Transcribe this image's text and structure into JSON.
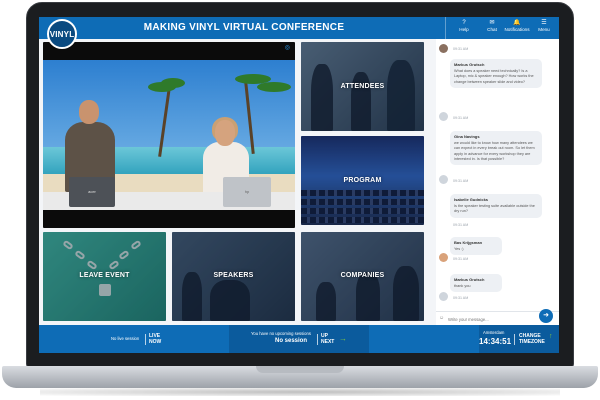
{
  "header": {
    "logo_text": "VINYL",
    "title": "MAKING VINYL VIRTUAL CONFERENCE",
    "nav": [
      {
        "icon": "?",
        "label": "Help"
      },
      {
        "icon": "✉",
        "label": "Chat"
      },
      {
        "icon": "🔔",
        "label": "Notifications"
      },
      {
        "icon": "☰",
        "label": "Menu"
      }
    ]
  },
  "video": {
    "laptop_brand_left": "acer",
    "laptop_brand_right": "hp"
  },
  "tiles": {
    "attendees": "ATTENDEES",
    "program": "PROGRAM",
    "leave_event": "LEAVE EVENT",
    "speakers": "SPEAKERS",
    "companies": "COMPANIES"
  },
  "chat": {
    "messages": [
      {
        "time": "09:31 AM"
      },
      {
        "author": "Markus Grutsch",
        "text": "What does a speaker need technically? Is a Laptop, mic & speaker enough? How works the change between speaker slide and video?",
        "time": "09:31 AM"
      },
      {
        "author": "Gina Navings",
        "text": "we would like to know how many attendees we can expect in every break out room. So let them apply in advance for every workshop they are interested in. Is that possible?",
        "time": "09:31 AM"
      },
      {
        "author": "Isabelle Gudnicks",
        "text": "Is the speaker testing suite available outside the dry run?",
        "time": "09:31 AM"
      },
      {
        "author": "Bas Krijgsman",
        "text": "Yes :)",
        "time": "09:31 AM"
      },
      {
        "author": "Markus Grutsch",
        "text": "thank you",
        "time": "09:31 AM"
      }
    ],
    "input_placeholder": "Write your message..."
  },
  "bottom": {
    "no_live": "No live session",
    "live_now_1": "LIVE",
    "live_now_2": "NOW",
    "upcoming_caption": "You have no upcoming sessions",
    "upcoming_value": "No session",
    "up_next_1": "UP",
    "up_next_2": "NEXT",
    "timezone_city": "Amsterdam",
    "clock": "14:34:51",
    "change_tz_1": "CHANGE",
    "change_tz_2": "TIMEZONE"
  },
  "colors": {
    "brand_blue": "#0e6cb6",
    "dark_blue": "#0b5b9d",
    "live_green": "#7ac143"
  }
}
